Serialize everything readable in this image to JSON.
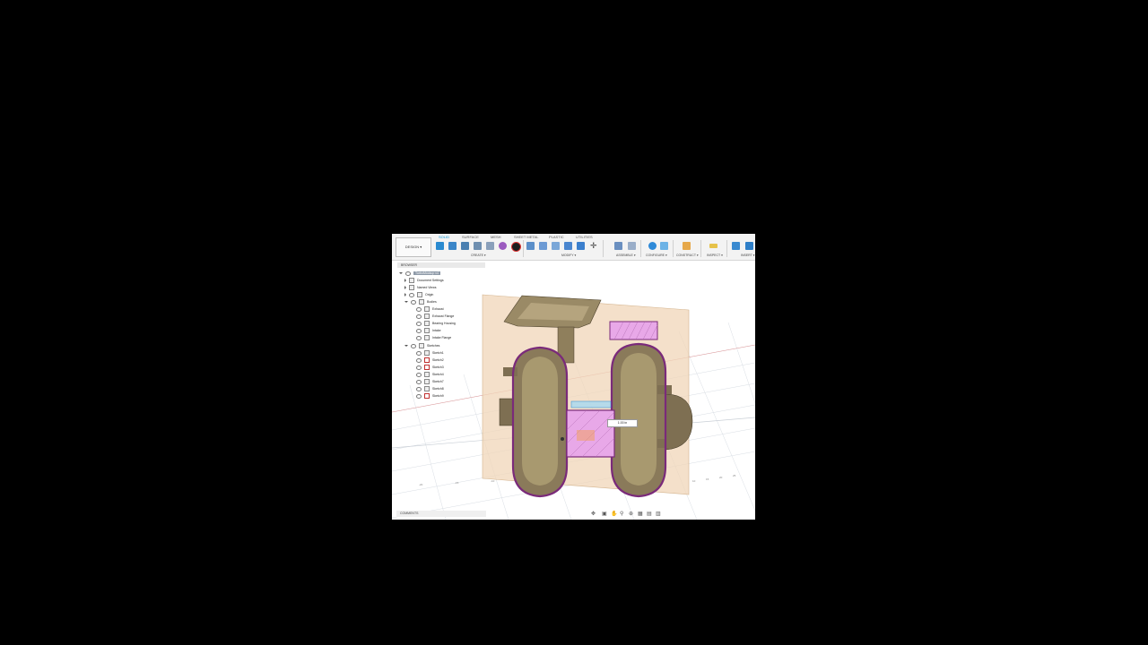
{
  "toolbar": {
    "workspace": "DESIGN ▾",
    "tabs": [
      "SOLID",
      "SURFACE",
      "MESH",
      "SHEET METAL",
      "PLASTIC",
      "UTILITIES"
    ],
    "groups": [
      "CREATE ▾",
      "MODIFY ▾",
      "ASSEMBLE ▾",
      "CONFIGURE ▾",
      "CONSTRUCT ▾",
      "INSPECT ▾",
      "INSERT ▾"
    ]
  },
  "browser": {
    "header": "BROWSER",
    "document": "TurboMockup v4",
    "items": {
      "document_settings": "Document Settings",
      "named_views": "Named Views",
      "origin": "Origin",
      "bodies": "Bodies",
      "body1": "Exhaust",
      "body2": "Exhaust Flange",
      "body3": "Bearing Housing",
      "body4": "Intake",
      "body5": "Intake Flange",
      "sketches": "Sketches",
      "sketch1": "Sketch1",
      "sketch2": "Sketch2",
      "sketch3": "Sketch3",
      "sketch4": "Sketch4",
      "sketch5": "Sketch7",
      "sketch6": "Sketch8",
      "sketch7": "Sketch9"
    }
  },
  "comments": "COMMENTS",
  "dimension_value": "1.00 in",
  "colors": {
    "body": "#8a7a5a",
    "section": "#e8a8e8",
    "plane": "#f0d6b8",
    "accent": "#0696d7"
  }
}
